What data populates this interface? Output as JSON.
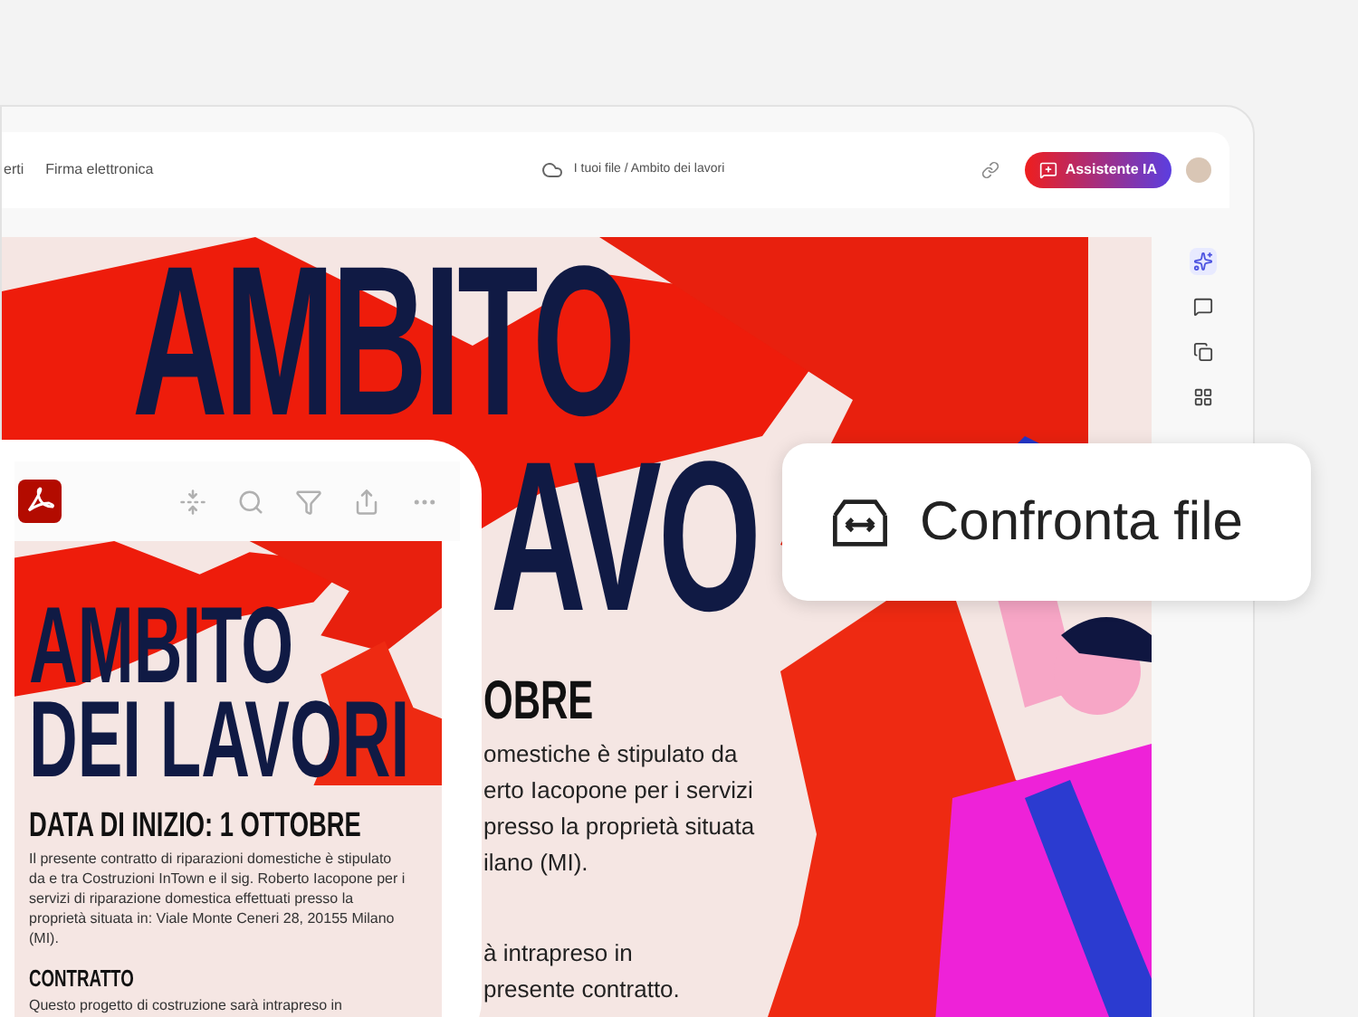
{
  "app_window": {
    "nav_items": [
      "erti",
      "Firma elettronica"
    ],
    "breadcrumb": "I tuoi file / Ambito dei lavori",
    "ai_button": "Assistente IA"
  },
  "document": {
    "title_lines": [
      "AMBITO",
      "AVO"
    ],
    "heading": "OBRE",
    "paragraph_lines": [
      "omestiche è stipulato da",
      "erto Iacopone per i servizi",
      "presso la proprietà situata",
      "ilano (MI)."
    ],
    "paragraph2_lines": [
      "à intrapreso in",
      "presente contratto."
    ]
  },
  "right_rail": [
    {
      "kind": "ai",
      "selected": true
    },
    {
      "kind": "comment",
      "selected": false
    },
    {
      "kind": "copy",
      "selected": false
    },
    {
      "kind": "grid",
      "selected": false
    }
  ],
  "phone": {
    "toolbar": [
      {
        "kind": "fit"
      },
      {
        "kind": "search"
      },
      {
        "kind": "filter"
      },
      {
        "kind": "share"
      },
      {
        "kind": "more"
      }
    ],
    "title_lines": [
      "AMBITO",
      "DEI LAVORI"
    ],
    "heading": "DATA DI INIZIO: 1 OTTOBRE",
    "paragraph": "Il presente contratto di riparazioni domestiche è stipulato da e tra Costruzioni InTown e il sig. Roberto Iacopone per i servizi di riparazione domestica effettuati presso la proprietà situata in: Viale Monte Ceneri 28, 20155 Milano (MI).",
    "subheading": "CONTRATTO",
    "paragraph2": "Questo progetto di costruzione sarà intrapreso in"
  },
  "callout": {
    "label": "Confronta file"
  }
}
